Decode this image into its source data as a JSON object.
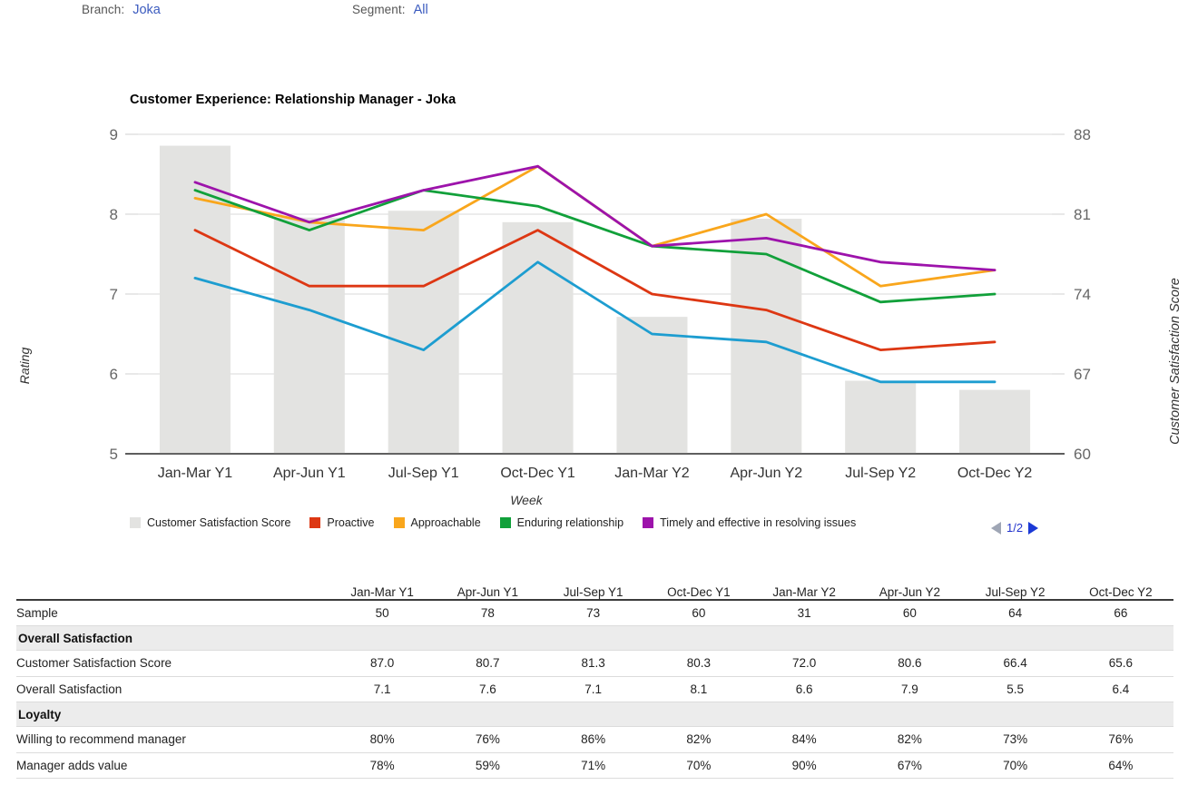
{
  "filters": [
    {
      "label": "Branch:",
      "value": "Joka",
      "name": "branch"
    },
    {
      "label": "Segment:",
      "value": "All",
      "name": "segment"
    }
  ],
  "chart": {
    "title": "Customer Experience: Relationship Manager - Joka",
    "pager": {
      "prev_icon": "triangle-left-icon",
      "label": "1/2",
      "next_icon": "triangle-right-icon"
    }
  },
  "chart_data": {
    "type": "line",
    "title": "Customer Experience: Relationship Manager - Joka",
    "xlabel": "Week",
    "ylabel": "Rating",
    "y2label": "Customer Satisfaction Score",
    "categories": [
      "Jan-Mar Y1",
      "Apr-Jun Y1",
      "Jul-Sep Y1",
      "Oct-Dec Y1",
      "Jan-Mar Y2",
      "Apr-Jun Y2",
      "Jul-Sep Y2",
      "Oct-Dec Y2"
    ],
    "ylim": [
      5,
      9
    ],
    "yticks": [
      5,
      6,
      7,
      8,
      9
    ],
    "y2lim": [
      60,
      88
    ],
    "y2ticks": [
      60,
      67,
      74,
      81,
      88
    ],
    "grid": true,
    "legend_position": "bottom",
    "bars": {
      "name": "Customer Satisfaction Score",
      "color": "#e3e3e1",
      "axis": "right",
      "values": [
        87.0,
        80.7,
        81.3,
        80.3,
        72.0,
        80.6,
        66.4,
        65.6
      ]
    },
    "series": [
      {
        "name": "Proactive",
        "color": "#dd3713",
        "axis": "left",
        "values": [
          7.8,
          7.1,
          7.1,
          7.8,
          7.0,
          6.8,
          6.3,
          6.4
        ]
      },
      {
        "name": "Approachable",
        "color": "#f9a61c",
        "axis": "left",
        "values": [
          8.2,
          7.9,
          7.8,
          8.6,
          7.6,
          8.0,
          7.1,
          7.3
        ]
      },
      {
        "name": "Enduring relationship",
        "color": "#11a03a",
        "axis": "left",
        "values": [
          8.3,
          7.8,
          8.3,
          8.1,
          7.6,
          7.5,
          6.9,
          7.0
        ]
      },
      {
        "name": "Timely and effective in resolving issues",
        "color": "#9d13ab",
        "axis": "left",
        "values": [
          8.4,
          7.9,
          8.3,
          8.6,
          7.6,
          7.7,
          7.4,
          7.3
        ]
      },
      {
        "name": "Overall Satisfaction",
        "color": "#1d9dd0",
        "axis": "left",
        "values": [
          7.2,
          6.8,
          6.3,
          7.4,
          6.5,
          6.4,
          5.9,
          5.9
        ]
      }
    ],
    "legend": [
      {
        "label": "Customer Satisfaction Score",
        "color": "#e3e3e1"
      },
      {
        "label": "Proactive",
        "color": "#dd3713"
      },
      {
        "label": "Approachable",
        "color": "#f9a61c"
      },
      {
        "label": "Enduring relationship",
        "color": "#11a03a"
      },
      {
        "label": "Timely and effective in resolving issues",
        "color": "#9d13ab"
      }
    ]
  },
  "table": {
    "headers": [
      "",
      "Jan-Mar Y1",
      "Apr-Jun Y1",
      "Jul-Sep Y1",
      "Oct-Dec Y1",
      "Jan-Mar Y2",
      "Apr-Jun Y2",
      "Jul-Sep Y2",
      "Oct-Dec Y2"
    ],
    "rows": [
      {
        "kind": "data",
        "name": "Sample",
        "values": [
          "50",
          "78",
          "73",
          "60",
          "31",
          "60",
          "64",
          "66"
        ],
        "colors": [
          "",
          "",
          "",
          "",
          "",
          "",
          "",
          ""
        ]
      },
      {
        "kind": "section",
        "name": "Overall Satisfaction"
      },
      {
        "kind": "data",
        "name": "Customer Satisfaction Score",
        "values": [
          "87.0",
          "80.7",
          "81.3",
          "80.3",
          "72.0",
          "80.6",
          "66.4",
          "65.6"
        ],
        "colors": [
          "green",
          "green",
          "green",
          "green",
          "green",
          "green",
          "",
          ""
        ]
      },
      {
        "kind": "data",
        "name": "Overall Satisfaction",
        "values": [
          "7.1",
          "7.6",
          "7.1",
          "8.1",
          "6.6",
          "7.9",
          "5.5",
          "6.4"
        ],
        "colors": [
          "",
          "",
          "",
          "green",
          "red",
          "",
          "red",
          "red"
        ]
      },
      {
        "kind": "section",
        "name": "Loyalty"
      },
      {
        "kind": "data",
        "name": "Willing to recommend manager",
        "values": [
          "80%",
          "76%",
          "86%",
          "82%",
          "84%",
          "82%",
          "73%",
          "76%"
        ],
        "colors": [
          "",
          "",
          "",
          "",
          "",
          "",
          "",
          ""
        ]
      },
      {
        "kind": "data",
        "name": "Manager adds value",
        "values": [
          "78%",
          "59%",
          "71%",
          "70%",
          "90%",
          "67%",
          "70%",
          "64%"
        ],
        "colors": [
          "",
          "",
          "",
          "",
          "",
          "",
          "",
          ""
        ]
      }
    ]
  }
}
